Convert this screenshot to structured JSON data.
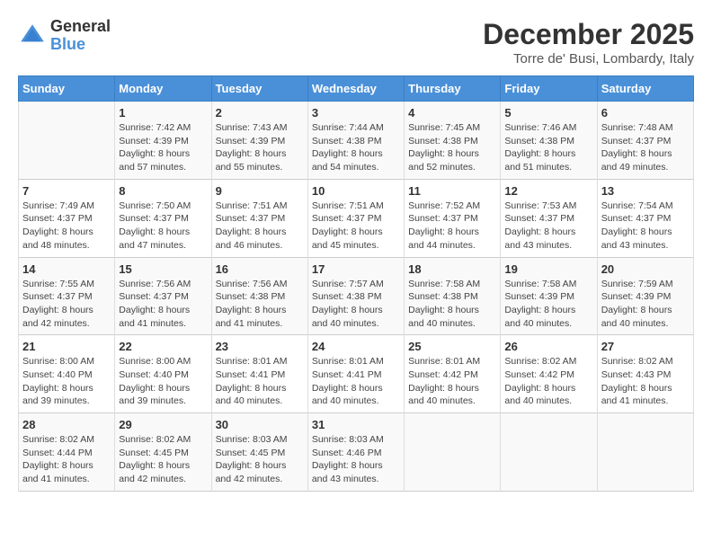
{
  "header": {
    "logo_general": "General",
    "logo_blue": "Blue",
    "month_title": "December 2025",
    "location": "Torre de' Busi, Lombardy, Italy"
  },
  "days_of_week": [
    "Sunday",
    "Monday",
    "Tuesday",
    "Wednesday",
    "Thursday",
    "Friday",
    "Saturday"
  ],
  "weeks": [
    [
      {
        "day": "",
        "sunrise": "",
        "sunset": "",
        "daylight": ""
      },
      {
        "day": "1",
        "sunrise": "Sunrise: 7:42 AM",
        "sunset": "Sunset: 4:39 PM",
        "daylight": "Daylight: 8 hours and 57 minutes."
      },
      {
        "day": "2",
        "sunrise": "Sunrise: 7:43 AM",
        "sunset": "Sunset: 4:39 PM",
        "daylight": "Daylight: 8 hours and 55 minutes."
      },
      {
        "day": "3",
        "sunrise": "Sunrise: 7:44 AM",
        "sunset": "Sunset: 4:38 PM",
        "daylight": "Daylight: 8 hours and 54 minutes."
      },
      {
        "day": "4",
        "sunrise": "Sunrise: 7:45 AM",
        "sunset": "Sunset: 4:38 PM",
        "daylight": "Daylight: 8 hours and 52 minutes."
      },
      {
        "day": "5",
        "sunrise": "Sunrise: 7:46 AM",
        "sunset": "Sunset: 4:38 PM",
        "daylight": "Daylight: 8 hours and 51 minutes."
      },
      {
        "day": "6",
        "sunrise": "Sunrise: 7:48 AM",
        "sunset": "Sunset: 4:37 PM",
        "daylight": "Daylight: 8 hours and 49 minutes."
      }
    ],
    [
      {
        "day": "7",
        "sunrise": "Sunrise: 7:49 AM",
        "sunset": "Sunset: 4:37 PM",
        "daylight": "Daylight: 8 hours and 48 minutes."
      },
      {
        "day": "8",
        "sunrise": "Sunrise: 7:50 AM",
        "sunset": "Sunset: 4:37 PM",
        "daylight": "Daylight: 8 hours and 47 minutes."
      },
      {
        "day": "9",
        "sunrise": "Sunrise: 7:51 AM",
        "sunset": "Sunset: 4:37 PM",
        "daylight": "Daylight: 8 hours and 46 minutes."
      },
      {
        "day": "10",
        "sunrise": "Sunrise: 7:51 AM",
        "sunset": "Sunset: 4:37 PM",
        "daylight": "Daylight: 8 hours and 45 minutes."
      },
      {
        "day": "11",
        "sunrise": "Sunrise: 7:52 AM",
        "sunset": "Sunset: 4:37 PM",
        "daylight": "Daylight: 8 hours and 44 minutes."
      },
      {
        "day": "12",
        "sunrise": "Sunrise: 7:53 AM",
        "sunset": "Sunset: 4:37 PM",
        "daylight": "Daylight: 8 hours and 43 minutes."
      },
      {
        "day": "13",
        "sunrise": "Sunrise: 7:54 AM",
        "sunset": "Sunset: 4:37 PM",
        "daylight": "Daylight: 8 hours and 43 minutes."
      }
    ],
    [
      {
        "day": "14",
        "sunrise": "Sunrise: 7:55 AM",
        "sunset": "Sunset: 4:37 PM",
        "daylight": "Daylight: 8 hours and 42 minutes."
      },
      {
        "day": "15",
        "sunrise": "Sunrise: 7:56 AM",
        "sunset": "Sunset: 4:37 PM",
        "daylight": "Daylight: 8 hours and 41 minutes."
      },
      {
        "day": "16",
        "sunrise": "Sunrise: 7:56 AM",
        "sunset": "Sunset: 4:38 PM",
        "daylight": "Daylight: 8 hours and 41 minutes."
      },
      {
        "day": "17",
        "sunrise": "Sunrise: 7:57 AM",
        "sunset": "Sunset: 4:38 PM",
        "daylight": "Daylight: 8 hours and 40 minutes."
      },
      {
        "day": "18",
        "sunrise": "Sunrise: 7:58 AM",
        "sunset": "Sunset: 4:38 PM",
        "daylight": "Daylight: 8 hours and 40 minutes."
      },
      {
        "day": "19",
        "sunrise": "Sunrise: 7:58 AM",
        "sunset": "Sunset: 4:39 PM",
        "daylight": "Daylight: 8 hours and 40 minutes."
      },
      {
        "day": "20",
        "sunrise": "Sunrise: 7:59 AM",
        "sunset": "Sunset: 4:39 PM",
        "daylight": "Daylight: 8 hours and 40 minutes."
      }
    ],
    [
      {
        "day": "21",
        "sunrise": "Sunrise: 8:00 AM",
        "sunset": "Sunset: 4:40 PM",
        "daylight": "Daylight: 8 hours and 39 minutes."
      },
      {
        "day": "22",
        "sunrise": "Sunrise: 8:00 AM",
        "sunset": "Sunset: 4:40 PM",
        "daylight": "Daylight: 8 hours and 39 minutes."
      },
      {
        "day": "23",
        "sunrise": "Sunrise: 8:01 AM",
        "sunset": "Sunset: 4:41 PM",
        "daylight": "Daylight: 8 hours and 40 minutes."
      },
      {
        "day": "24",
        "sunrise": "Sunrise: 8:01 AM",
        "sunset": "Sunset: 4:41 PM",
        "daylight": "Daylight: 8 hours and 40 minutes."
      },
      {
        "day": "25",
        "sunrise": "Sunrise: 8:01 AM",
        "sunset": "Sunset: 4:42 PM",
        "daylight": "Daylight: 8 hours and 40 minutes."
      },
      {
        "day": "26",
        "sunrise": "Sunrise: 8:02 AM",
        "sunset": "Sunset: 4:42 PM",
        "daylight": "Daylight: 8 hours and 40 minutes."
      },
      {
        "day": "27",
        "sunrise": "Sunrise: 8:02 AM",
        "sunset": "Sunset: 4:43 PM",
        "daylight": "Daylight: 8 hours and 41 minutes."
      }
    ],
    [
      {
        "day": "28",
        "sunrise": "Sunrise: 8:02 AM",
        "sunset": "Sunset: 4:44 PM",
        "daylight": "Daylight: 8 hours and 41 minutes."
      },
      {
        "day": "29",
        "sunrise": "Sunrise: 8:02 AM",
        "sunset": "Sunset: 4:45 PM",
        "daylight": "Daylight: 8 hours and 42 minutes."
      },
      {
        "day": "30",
        "sunrise": "Sunrise: 8:03 AM",
        "sunset": "Sunset: 4:45 PM",
        "daylight": "Daylight: 8 hours and 42 minutes."
      },
      {
        "day": "31",
        "sunrise": "Sunrise: 8:03 AM",
        "sunset": "Sunset: 4:46 PM",
        "daylight": "Daylight: 8 hours and 43 minutes."
      },
      {
        "day": "",
        "sunrise": "",
        "sunset": "",
        "daylight": ""
      },
      {
        "day": "",
        "sunrise": "",
        "sunset": "",
        "daylight": ""
      },
      {
        "day": "",
        "sunrise": "",
        "sunset": "",
        "daylight": ""
      }
    ]
  ]
}
